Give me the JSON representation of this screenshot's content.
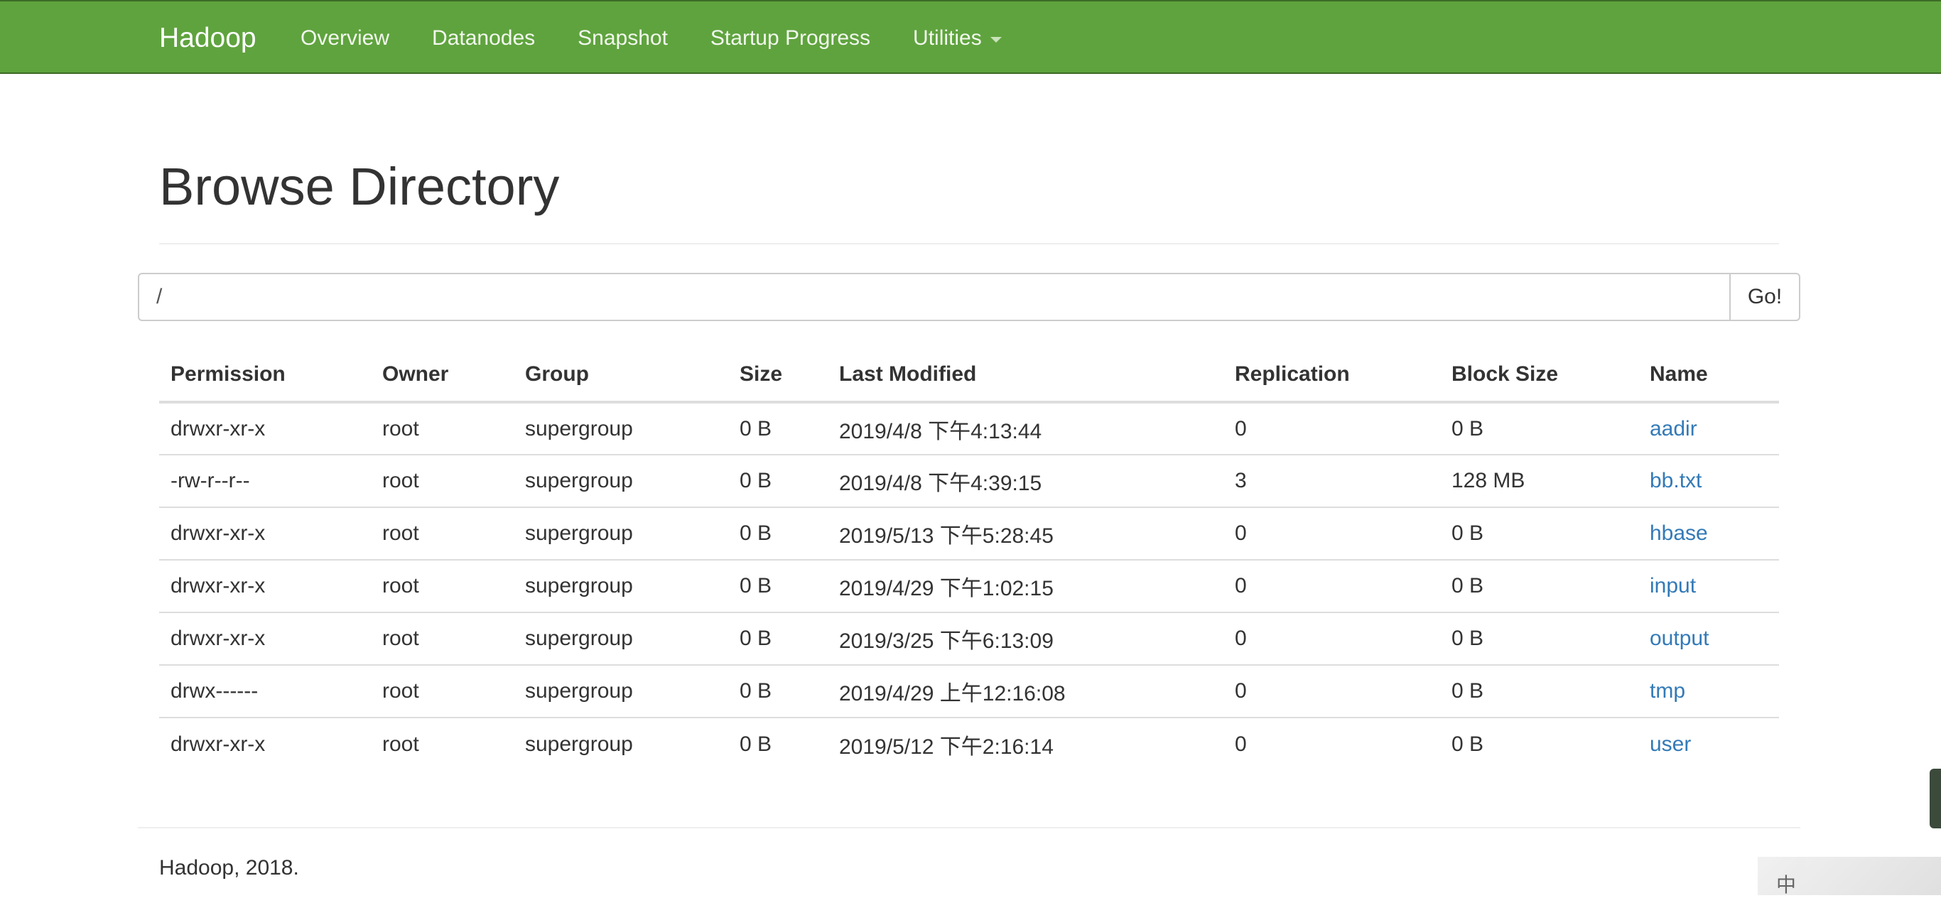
{
  "navbar": {
    "brand": "Hadoop",
    "items": [
      {
        "label": "Overview"
      },
      {
        "label": "Datanodes"
      },
      {
        "label": "Snapshot"
      },
      {
        "label": "Startup Progress"
      },
      {
        "label": "Utilities",
        "dropdown": true
      }
    ],
    "colors": {
      "background": "#5fa33e",
      "text": "#ffffff"
    }
  },
  "page": {
    "title": "Browse Directory"
  },
  "search": {
    "value": "/",
    "go_label": "Go!"
  },
  "table": {
    "headers": [
      "Permission",
      "Owner",
      "Group",
      "Size",
      "Last Modified",
      "Replication",
      "Block Size",
      "Name"
    ],
    "rows": [
      [
        "drwxr-xr-x",
        "root",
        "supergroup",
        "0 B",
        "2019/4/8 下午4:13:44",
        "0",
        "0 B",
        "aadir"
      ],
      [
        "-rw-r--r--",
        "root",
        "supergroup",
        "0 B",
        "2019/4/8 下午4:39:15",
        "3",
        "128 MB",
        "bb.txt"
      ],
      [
        "drwxr-xr-x",
        "root",
        "supergroup",
        "0 B",
        "2019/5/13 下午5:28:45",
        "0",
        "0 B",
        "hbase"
      ],
      [
        "drwxr-xr-x",
        "root",
        "supergroup",
        "0 B",
        "2019/4/29 下午1:02:15",
        "0",
        "0 B",
        "input"
      ],
      [
        "drwxr-xr-x",
        "root",
        "supergroup",
        "0 B",
        "2019/3/25 下午6:13:09",
        "0",
        "0 B",
        "output"
      ],
      [
        "drwx------",
        "root",
        "supergroup",
        "0 B",
        "2019/4/29 上午12:16:08",
        "0",
        "0 B",
        "tmp"
      ],
      [
        "drwxr-xr-x",
        "root",
        "supergroup",
        "0 B",
        "2019/5/12 下午2:16:14",
        "0",
        "0 B",
        "user"
      ]
    ],
    "link_color": "#337ab7"
  },
  "footer": {
    "text": "Hadoop, 2018."
  },
  "watermark": {
    "glyph": "中"
  }
}
